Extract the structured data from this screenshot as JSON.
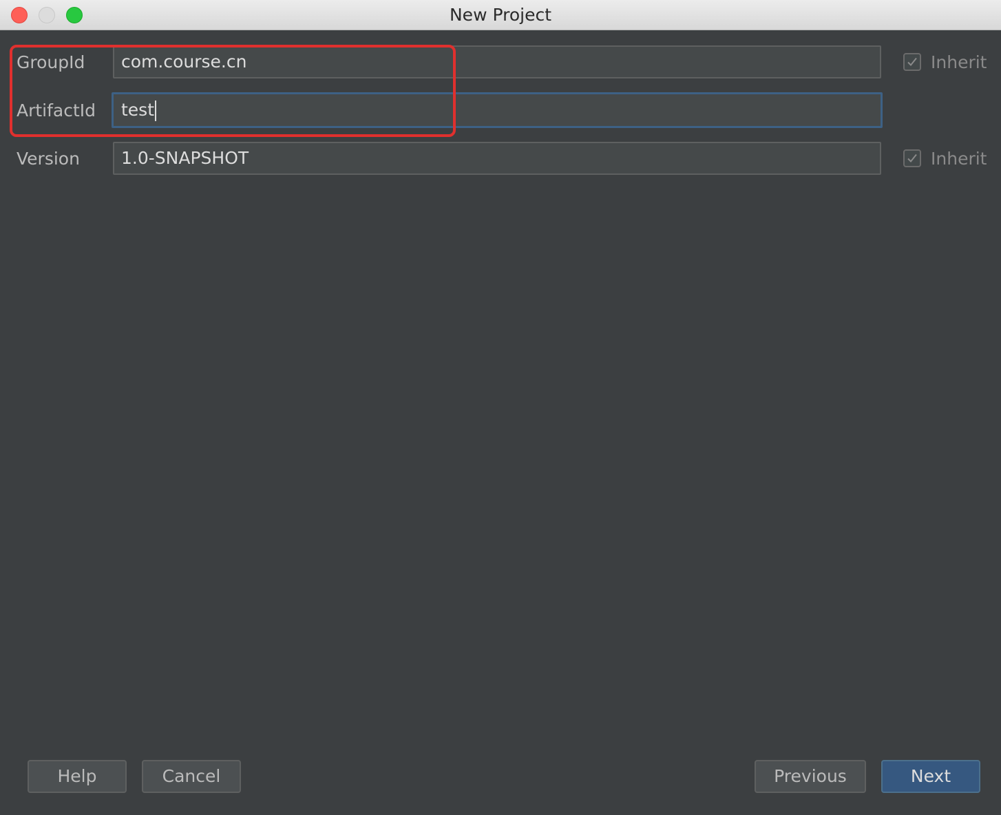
{
  "window": {
    "title": "New Project"
  },
  "form": {
    "group_id": {
      "label": "GroupId",
      "value": "com.course.cn",
      "inherit_label": "Inherit",
      "inherit_checked": true
    },
    "artifact_id": {
      "label": "ArtifactId",
      "value": "test"
    },
    "version": {
      "label": "Version",
      "value": "1.0-SNAPSHOT",
      "inherit_label": "Inherit",
      "inherit_checked": true
    }
  },
  "buttons": {
    "help": "Help",
    "cancel": "Cancel",
    "previous": "Previous",
    "next": "Next"
  },
  "colors": {
    "background": "#3c3f41",
    "field_background": "#45494a",
    "focus_border": "#3d6185",
    "primary_button": "#365880",
    "annotation": "#e0302e"
  }
}
